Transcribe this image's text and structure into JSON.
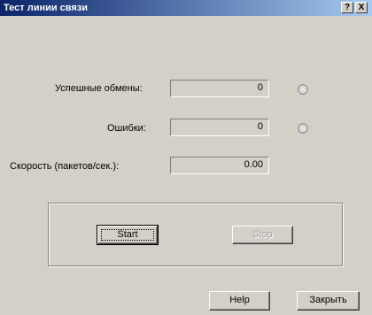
{
  "window": {
    "title": "Тест линии связи",
    "help_button": "?",
    "close_button": "X"
  },
  "stats": {
    "success_label": "Успешные обмены:",
    "success_value": "0",
    "errors_label": "Ошибки:",
    "errors_value": "0",
    "speed_label": "Скорость  (пакетов/сек.):",
    "speed_value": "0.00"
  },
  "controls": {
    "start_label": "Start",
    "stop_label": "Stop"
  },
  "footer": {
    "help_label": "Help",
    "close_label": "Закрыть"
  }
}
